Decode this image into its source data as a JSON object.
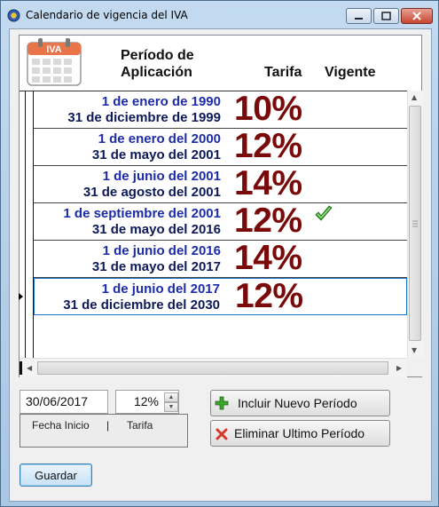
{
  "window": {
    "title": "Calendario de vigencia del IVA",
    "controls": [
      "minimize-icon",
      "maximize-icon",
      "close-icon"
    ]
  },
  "grid": {
    "header": {
      "icon_label": "IVA",
      "period_line1": "Período de",
      "period_line2": "Aplicación",
      "rate": "Tarifa",
      "current": "Vigente"
    },
    "rows": [
      {
        "start": "1 de enero de 1990",
        "end": "31 de diciembre de 1999",
        "rate": "10%",
        "current": false
      },
      {
        "start": "1 de enero del 2000",
        "end": "31 de mayo del 2001",
        "rate": "12%",
        "current": false
      },
      {
        "start": "1 de junio del 2001",
        "end": "31 de agosto del 2001",
        "rate": "14%",
        "current": false
      },
      {
        "start": "1 de septiembre del 2001",
        "end": "31 de mayo del 2016",
        "rate": "12%",
        "current": true
      },
      {
        "start": "1 de junio del 2016",
        "end": "31 de mayo del 2017",
        "rate": "14%",
        "current": false
      },
      {
        "start": "1 de junio del 2017",
        "end": "31 de diciembre del 2030",
        "rate": "12%",
        "current": false,
        "selected": true
      }
    ]
  },
  "form": {
    "date_value": "30/06/2017",
    "rate_value": "12%",
    "legend_date": "Fecha Inicio",
    "legend_sep": "|",
    "legend_rate": "Tarifa",
    "add_label": "Incluir Nuevo Período",
    "remove_label": "Eliminar Ultimo Período",
    "save_label": "Guardar"
  },
  "colors": {
    "date_start": "#1c2ca8",
    "date_end": "#0d1a5a",
    "rate": "#7a0a0a",
    "check": "#3aa52a"
  }
}
